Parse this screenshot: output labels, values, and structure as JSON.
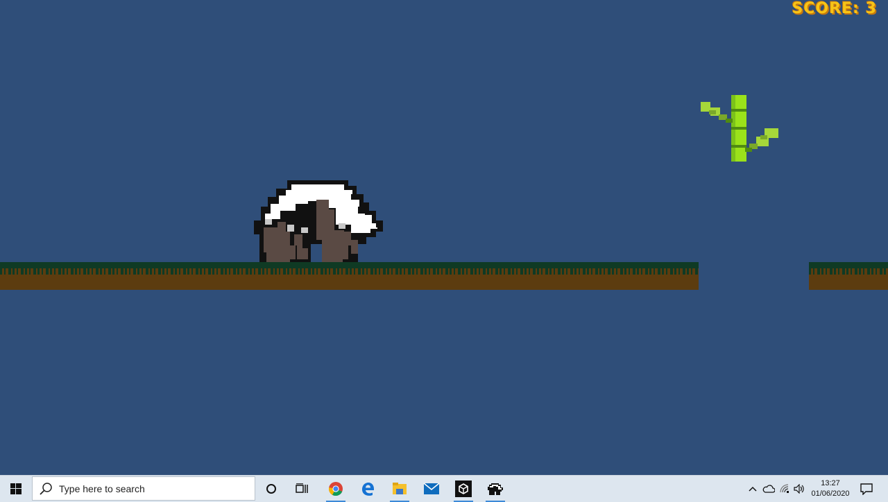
{
  "game": {
    "score_label": "SCORE:",
    "score_value": "3",
    "colors": {
      "sky": "#2f4e79",
      "grass": "#0f3a24",
      "dirt": "#5c3c0f",
      "score": "#f7c417",
      "bamboo": "#9be21a"
    },
    "sprites": [
      "panda",
      "bamboo"
    ]
  },
  "taskbar": {
    "search_placeholder": "Type here to search",
    "apps": [
      "task-view",
      "chrome",
      "edge",
      "file-explorer",
      "mail",
      "unity",
      "panda-game"
    ],
    "clock": {
      "time": "13:27",
      "date": "01/06/2020"
    }
  }
}
